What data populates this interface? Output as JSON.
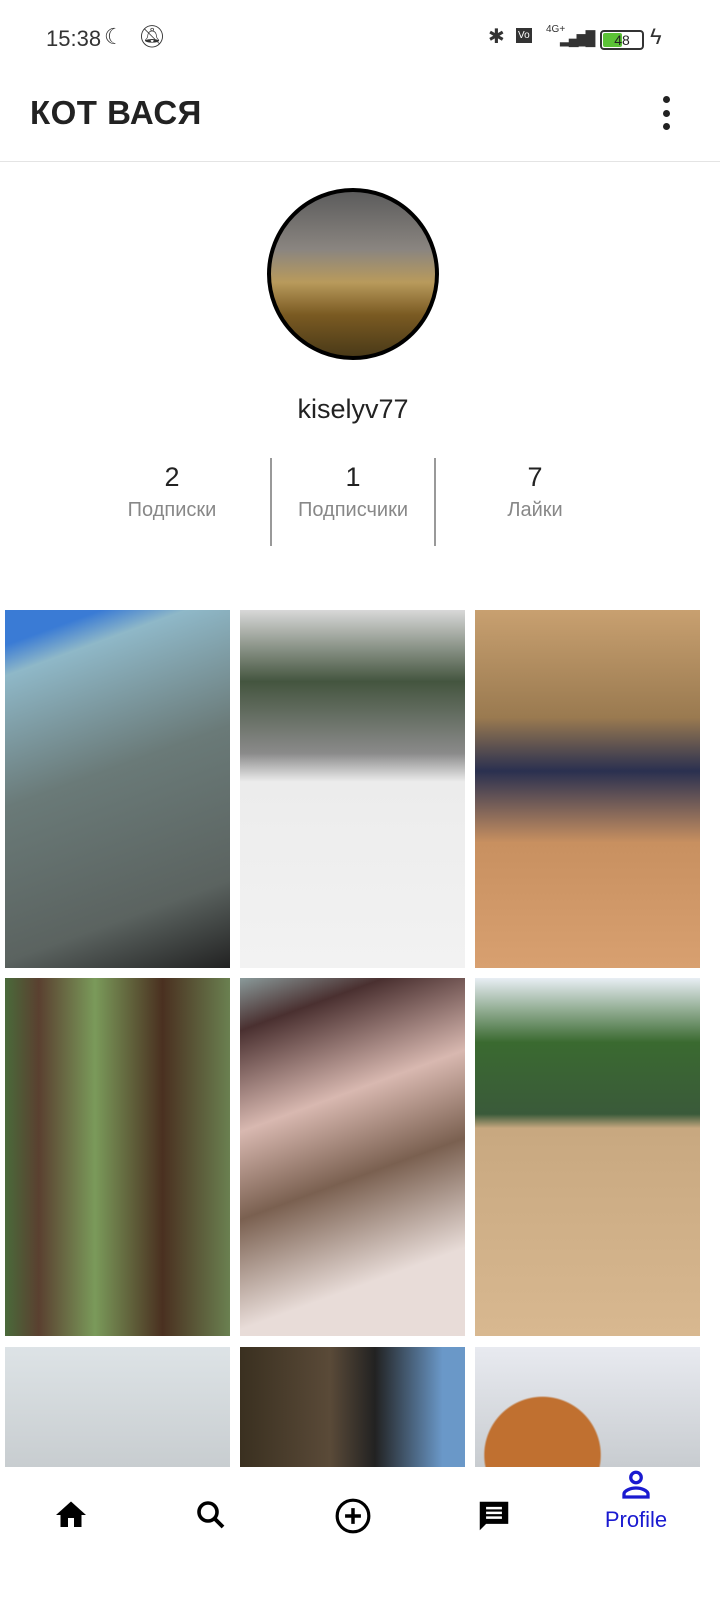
{
  "status": {
    "time": "15:38",
    "network": "4G+",
    "battery": "48"
  },
  "appbar": {
    "title": "КОТ ВАСЯ"
  },
  "profile": {
    "username": "kiselyv77",
    "stats": [
      {
        "value": "2",
        "label": "Подписки"
      },
      {
        "value": "1",
        "label": "Подписчики"
      },
      {
        "value": "7",
        "label": "Лайки"
      }
    ]
  },
  "nav": {
    "items": [
      "home",
      "search",
      "add",
      "messages",
      "profile"
    ],
    "active_label": "Profile"
  },
  "colors": {
    "accent": "#1a1ad0"
  }
}
